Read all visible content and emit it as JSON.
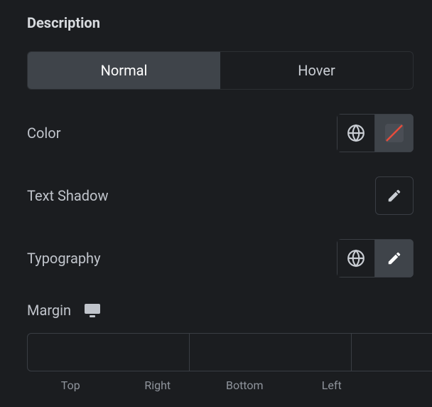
{
  "section_title": "Description",
  "tabs": {
    "normal": "Normal",
    "hover": "Hover"
  },
  "color": {
    "label": "Color"
  },
  "text_shadow": {
    "label": "Text Shadow"
  },
  "typography": {
    "label": "Typography"
  },
  "margin": {
    "label": "Margin",
    "top": "Top",
    "right": "Right",
    "bottom": "Bottom",
    "left": "Left",
    "values": {
      "top": "",
      "right": "",
      "bottom": "",
      "left": ""
    }
  }
}
